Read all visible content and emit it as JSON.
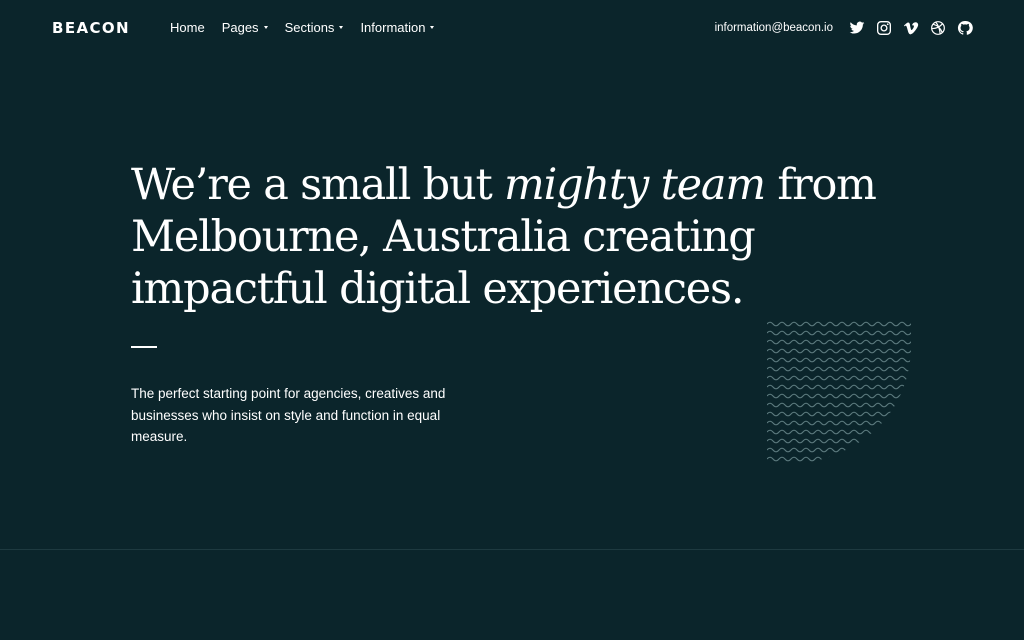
{
  "brand": {
    "name": "BEACON"
  },
  "nav": {
    "items": [
      {
        "label": "Home",
        "has_dropdown": false
      },
      {
        "label": "Pages",
        "has_dropdown": true
      },
      {
        "label": "Sections",
        "has_dropdown": true
      },
      {
        "label": "Information",
        "has_dropdown": true
      }
    ]
  },
  "contact": {
    "email": "information@beacon.io"
  },
  "social": [
    {
      "icon": "twitter-icon"
    },
    {
      "icon": "instagram-icon"
    },
    {
      "icon": "vimeo-icon"
    },
    {
      "icon": "dribbble-icon"
    },
    {
      "icon": "github-icon"
    }
  ],
  "hero": {
    "title_before": "We’re a small but ",
    "title_emphasis": "mighty team",
    "title_after": " from Melbourne, Australia creating impactful digital experiences.",
    "subtitle": "The perfect starting point for agencies, creatives and businesses who insist on style and function in equal measure."
  },
  "colors": {
    "background": "#0b252b",
    "text": "#ffffff",
    "wave_pattern": "#5c7a7e",
    "section_divider": "#1e3a40"
  }
}
